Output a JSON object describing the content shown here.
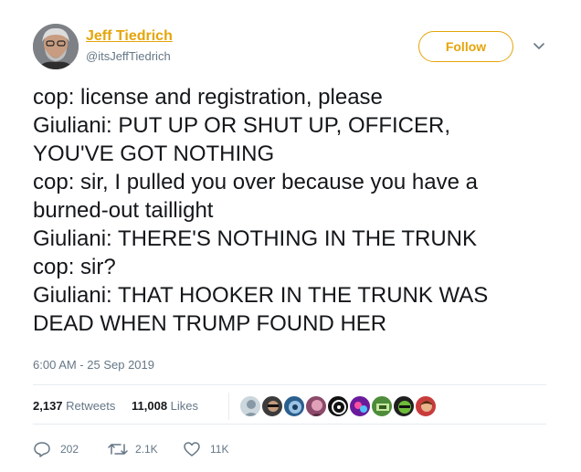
{
  "user": {
    "name": "Jeff Tiedrich",
    "handle": "@itsJeffTiedrich",
    "follow_label": "Follow"
  },
  "tweet": {
    "lines": [
      "cop: license and registration, please",
      "Giuliani: PUT UP OR SHUT UP, OFFICER,",
      "YOU'VE GOT NOTHING",
      "cop: sir, I pulled you over because you have a",
      "burned-out taillight",
      "Giuliani: THERE'S NOTHING IN THE TRUNK",
      "cop: sir?",
      "Giuliani: THAT HOOKER IN THE TRUNK WAS",
      "DEAD WHEN TRUMP FOUND HER"
    ],
    "timestamp": "6:00 AM - 25 Sep 2019"
  },
  "stats": {
    "retweets_count": "2,137",
    "retweets_label": "Retweets",
    "likes_count": "11,008",
    "likes_label": "Likes"
  },
  "actions": {
    "reply_count": "202",
    "retweet_count": "2.1K",
    "like_count": "11K"
  },
  "colors": {
    "accent": "#e5a50a",
    "secondary_text": "#657786",
    "divider": "#e6ecf0"
  }
}
